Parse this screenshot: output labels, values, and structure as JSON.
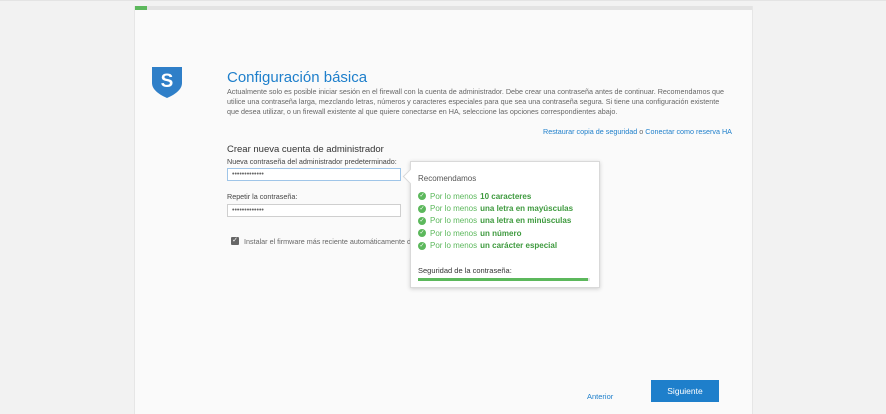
{
  "wizard": {
    "progress_percent": 2
  },
  "header": {
    "title": "Configuración básica",
    "intro": "Actualmente solo es posible iniciar sesión en el firewall con la cuenta de administrador. Debe crear una contraseña antes de continuar. Recomendamos que utilice una contraseña larga, mezclando letras, números y caracteres especiales para que sea una contraseña segura. Si tiene una configuración existente que desea utilizar, o un firewall existente al que quiere conectarse en HA, seleccione las opciones correspondientes abajo."
  },
  "links": {
    "restore": "Restaurar copia de seguridad",
    "separator": "o",
    "ha": "Conectar como reserva HA"
  },
  "form": {
    "section_title": "Crear nueva cuenta de administrador",
    "password_label": "Nueva contraseña del administrador predeterminado:",
    "password_value": "•••••••••••••",
    "repeat_label": "Repetir la contraseña:",
    "repeat_value": "•••••••••••••",
    "firmware_checked": true,
    "firmware_label": "Instalar el firmware más reciente automáticamente d"
  },
  "popover": {
    "title": "Recomendamos",
    "requirements": [
      {
        "prefix": "Por lo menos",
        "emphasis": "10 caracteres",
        "met": true
      },
      {
        "prefix": "Por lo menos",
        "emphasis": "una letra en mayúsculas",
        "met": true
      },
      {
        "prefix": "Por lo menos",
        "emphasis": "una letra en minúsculas",
        "met": true
      },
      {
        "prefix": "Por lo menos",
        "emphasis": "un número",
        "met": true
      },
      {
        "prefix": "Por lo menos",
        "emphasis": "un carácter especial",
        "met": true
      }
    ],
    "strength_label": "Seguridad de la contraseña:",
    "strength_percent": 99
  },
  "footer": {
    "back_label": "Anterior",
    "next_label": "Siguiente"
  },
  "colors": {
    "accent": "#1e7fcb",
    "success": "#5cb85c",
    "logo": "#2f7fc8"
  },
  "icons": {
    "logo": "shield-s-logo",
    "check": "check-circle-icon",
    "checkbox": "checkbox-checked-icon"
  }
}
